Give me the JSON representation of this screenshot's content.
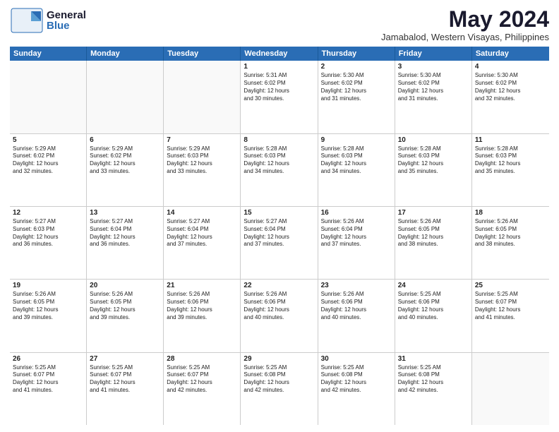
{
  "header": {
    "logo_general": "General",
    "logo_blue": "Blue",
    "main_title": "May 2024",
    "subtitle": "Jamabalod, Western Visayas, Philippines"
  },
  "days_of_week": [
    "Sunday",
    "Monday",
    "Tuesday",
    "Wednesday",
    "Thursday",
    "Friday",
    "Saturday"
  ],
  "weeks": [
    [
      {
        "day": "",
        "content": "",
        "empty": true
      },
      {
        "day": "",
        "content": "",
        "empty": true
      },
      {
        "day": "",
        "content": "",
        "empty": true
      },
      {
        "day": "1",
        "content": "Sunrise: 5:31 AM\nSunset: 6:02 PM\nDaylight: 12 hours\nand 30 minutes.",
        "empty": false
      },
      {
        "day": "2",
        "content": "Sunrise: 5:30 AM\nSunset: 6:02 PM\nDaylight: 12 hours\nand 31 minutes.",
        "empty": false
      },
      {
        "day": "3",
        "content": "Sunrise: 5:30 AM\nSunset: 6:02 PM\nDaylight: 12 hours\nand 31 minutes.",
        "empty": false
      },
      {
        "day": "4",
        "content": "Sunrise: 5:30 AM\nSunset: 6:02 PM\nDaylight: 12 hours\nand 32 minutes.",
        "empty": false
      }
    ],
    [
      {
        "day": "5",
        "content": "Sunrise: 5:29 AM\nSunset: 6:02 PM\nDaylight: 12 hours\nand 32 minutes.",
        "empty": false
      },
      {
        "day": "6",
        "content": "Sunrise: 5:29 AM\nSunset: 6:02 PM\nDaylight: 12 hours\nand 33 minutes.",
        "empty": false
      },
      {
        "day": "7",
        "content": "Sunrise: 5:29 AM\nSunset: 6:03 PM\nDaylight: 12 hours\nand 33 minutes.",
        "empty": false
      },
      {
        "day": "8",
        "content": "Sunrise: 5:28 AM\nSunset: 6:03 PM\nDaylight: 12 hours\nand 34 minutes.",
        "empty": false
      },
      {
        "day": "9",
        "content": "Sunrise: 5:28 AM\nSunset: 6:03 PM\nDaylight: 12 hours\nand 34 minutes.",
        "empty": false
      },
      {
        "day": "10",
        "content": "Sunrise: 5:28 AM\nSunset: 6:03 PM\nDaylight: 12 hours\nand 35 minutes.",
        "empty": false
      },
      {
        "day": "11",
        "content": "Sunrise: 5:28 AM\nSunset: 6:03 PM\nDaylight: 12 hours\nand 35 minutes.",
        "empty": false
      }
    ],
    [
      {
        "day": "12",
        "content": "Sunrise: 5:27 AM\nSunset: 6:03 PM\nDaylight: 12 hours\nand 36 minutes.",
        "empty": false
      },
      {
        "day": "13",
        "content": "Sunrise: 5:27 AM\nSunset: 6:04 PM\nDaylight: 12 hours\nand 36 minutes.",
        "empty": false
      },
      {
        "day": "14",
        "content": "Sunrise: 5:27 AM\nSunset: 6:04 PM\nDaylight: 12 hours\nand 37 minutes.",
        "empty": false
      },
      {
        "day": "15",
        "content": "Sunrise: 5:27 AM\nSunset: 6:04 PM\nDaylight: 12 hours\nand 37 minutes.",
        "empty": false
      },
      {
        "day": "16",
        "content": "Sunrise: 5:26 AM\nSunset: 6:04 PM\nDaylight: 12 hours\nand 37 minutes.",
        "empty": false
      },
      {
        "day": "17",
        "content": "Sunrise: 5:26 AM\nSunset: 6:05 PM\nDaylight: 12 hours\nand 38 minutes.",
        "empty": false
      },
      {
        "day": "18",
        "content": "Sunrise: 5:26 AM\nSunset: 6:05 PM\nDaylight: 12 hours\nand 38 minutes.",
        "empty": false
      }
    ],
    [
      {
        "day": "19",
        "content": "Sunrise: 5:26 AM\nSunset: 6:05 PM\nDaylight: 12 hours\nand 39 minutes.",
        "empty": false
      },
      {
        "day": "20",
        "content": "Sunrise: 5:26 AM\nSunset: 6:05 PM\nDaylight: 12 hours\nand 39 minutes.",
        "empty": false
      },
      {
        "day": "21",
        "content": "Sunrise: 5:26 AM\nSunset: 6:06 PM\nDaylight: 12 hours\nand 39 minutes.",
        "empty": false
      },
      {
        "day": "22",
        "content": "Sunrise: 5:26 AM\nSunset: 6:06 PM\nDaylight: 12 hours\nand 40 minutes.",
        "empty": false
      },
      {
        "day": "23",
        "content": "Sunrise: 5:26 AM\nSunset: 6:06 PM\nDaylight: 12 hours\nand 40 minutes.",
        "empty": false
      },
      {
        "day": "24",
        "content": "Sunrise: 5:25 AM\nSunset: 6:06 PM\nDaylight: 12 hours\nand 40 minutes.",
        "empty": false
      },
      {
        "day": "25",
        "content": "Sunrise: 5:25 AM\nSunset: 6:07 PM\nDaylight: 12 hours\nand 41 minutes.",
        "empty": false
      }
    ],
    [
      {
        "day": "26",
        "content": "Sunrise: 5:25 AM\nSunset: 6:07 PM\nDaylight: 12 hours\nand 41 minutes.",
        "empty": false
      },
      {
        "day": "27",
        "content": "Sunrise: 5:25 AM\nSunset: 6:07 PM\nDaylight: 12 hours\nand 41 minutes.",
        "empty": false
      },
      {
        "day": "28",
        "content": "Sunrise: 5:25 AM\nSunset: 6:07 PM\nDaylight: 12 hours\nand 42 minutes.",
        "empty": false
      },
      {
        "day": "29",
        "content": "Sunrise: 5:25 AM\nSunset: 6:08 PM\nDaylight: 12 hours\nand 42 minutes.",
        "empty": false
      },
      {
        "day": "30",
        "content": "Sunrise: 5:25 AM\nSunset: 6:08 PM\nDaylight: 12 hours\nand 42 minutes.",
        "empty": false
      },
      {
        "day": "31",
        "content": "Sunrise: 5:25 AM\nSunset: 6:08 PM\nDaylight: 12 hours\nand 42 minutes.",
        "empty": false
      },
      {
        "day": "",
        "content": "",
        "empty": true
      }
    ]
  ]
}
